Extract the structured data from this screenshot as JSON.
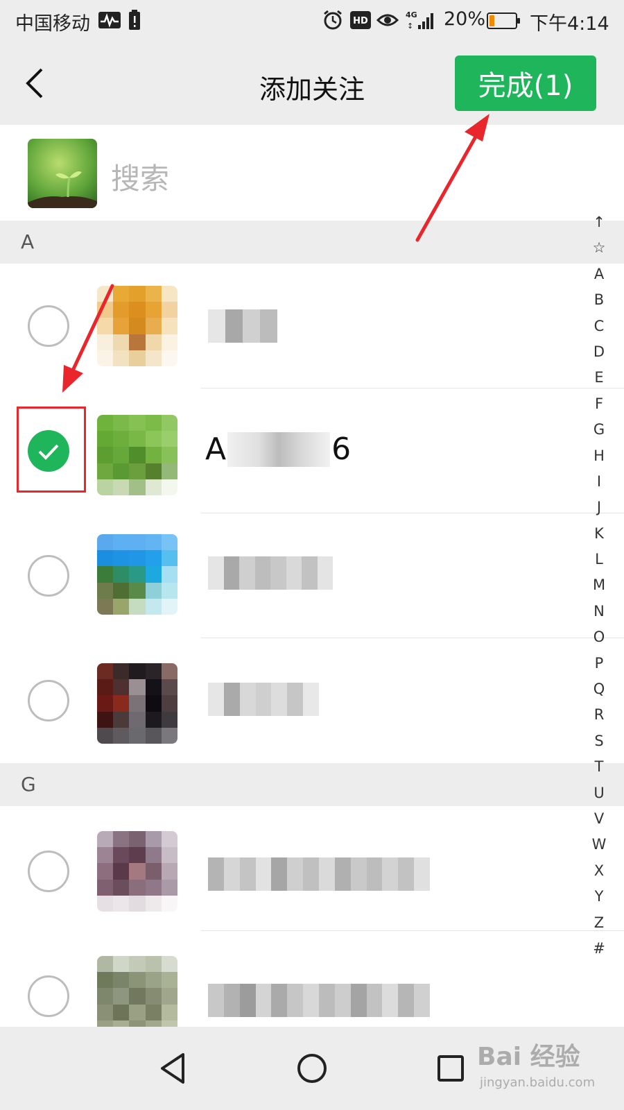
{
  "status_bar": {
    "carrier": "中国移动",
    "network": "4G",
    "battery_percent": "20%",
    "battery_level": 0.2,
    "time": "下午4:14",
    "icons": [
      "activity-icon",
      "sim-alert-icon",
      "alarm-icon",
      "hd-icon",
      "eye-icon",
      "signal-icon"
    ]
  },
  "navbar": {
    "back_icon": "chevron-left-icon",
    "title": "添加关注",
    "done_label": "完成(1)",
    "accent_color": "#1fb55a"
  },
  "search": {
    "placeholder": "搜索"
  },
  "sections": [
    {
      "letter": "A",
      "contacts": [
        {
          "checked": false,
          "name": ""
        },
        {
          "checked": true,
          "name_prefix": "A",
          "name_suffix": "6"
        },
        {
          "checked": false,
          "name": ""
        },
        {
          "checked": false,
          "name": ""
        }
      ]
    },
    {
      "letter": "G",
      "contacts": [
        {
          "checked": false,
          "name": ""
        },
        {
          "checked": false,
          "name": ""
        }
      ]
    }
  ],
  "index_bar": [
    "↑",
    "☆",
    "A",
    "B",
    "C",
    "D",
    "E",
    "F",
    "G",
    "H",
    "I",
    "J",
    "K",
    "L",
    "M",
    "N",
    "O",
    "P",
    "Q",
    "R",
    "S",
    "T",
    "U",
    "V",
    "W",
    "X",
    "Y",
    "Z",
    "#"
  ],
  "annotation": {
    "color": "#e8262b"
  },
  "watermark": {
    "logo": "Bai 经验",
    "url": "jingyan.baidu.com"
  }
}
